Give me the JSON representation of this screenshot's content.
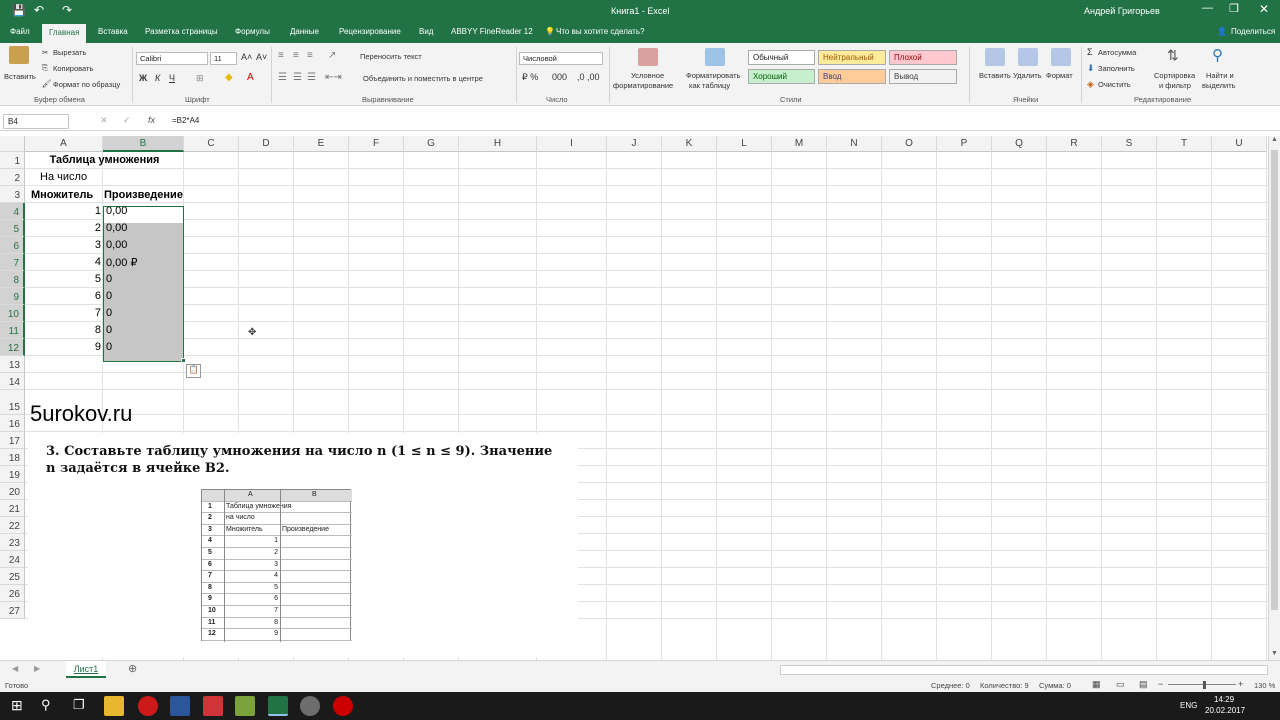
{
  "titlebar": {
    "title": "Книга1 - Excel",
    "user": "Андрей Григорьев"
  },
  "tabs": {
    "file": "Файл",
    "home": "Главная",
    "insert": "Вставка",
    "layout": "Разметка страницы",
    "formulas": "Формулы",
    "data": "Данные",
    "review": "Рецензирование",
    "view": "Вид",
    "abbyy": "ABBYY FineReader 12",
    "tellme": "Что вы хотите сделать?",
    "share": "Поделиться"
  },
  "ribbon": {
    "paste": "Вставить",
    "cut": "Вырезать",
    "copy": "Копировать",
    "format_painter": "Формат по образцу",
    "clipboard": "Буфер обмена",
    "font_name": "Calibri",
    "font_size": "11",
    "font_group": "Шрифт",
    "wrap": "Переносить текст",
    "merge": "Объединить и поместить в центре",
    "alignment": "Выравнивание",
    "number_format": "Числовой",
    "number_group": "Число",
    "cond_format_1": "Условное",
    "cond_format_2": "форматирование",
    "format_table_1": "Форматировать",
    "format_table_2": "как таблицу",
    "styles": [
      "Обычный",
      "Нейтральный",
      "Плохой",
      "Хороший",
      "Ввод",
      "Вывод"
    ],
    "styles_group": "Стили",
    "insert": "Вставить",
    "delete": "Удалить",
    "format": "Формат",
    "cells_group": "Ячейки",
    "autosum": "Автосумма",
    "fill": "Заполнить",
    "clear": "Очистить",
    "sort_1": "Сортировка",
    "sort_2": "и фильтр",
    "find_1": "Найти и",
    "find_2": "выделить",
    "editing_group": "Редактирование"
  },
  "formula_bar": {
    "name_box": "B4",
    "fx": "fx",
    "formula": "=B2*A4"
  },
  "columns": [
    "A",
    "B",
    "C",
    "D",
    "E",
    "F",
    "G",
    "H",
    "I",
    "J",
    "K",
    "L",
    "M",
    "N",
    "O",
    "P",
    "Q",
    "R",
    "S",
    "T",
    "U"
  ],
  "rows": [
    "1",
    "2",
    "3",
    "4",
    "5",
    "6",
    "7",
    "8",
    "9",
    "10",
    "11",
    "12",
    "13",
    "14",
    "15",
    "16",
    "17",
    "18",
    "19",
    "20",
    "21",
    "22",
    "23",
    "24",
    "25",
    "26",
    "27"
  ],
  "cells": {
    "a1": "Таблица умножения",
    "a2": "На число",
    "a3": "Множитель",
    "b3": "Произведение",
    "a_values": [
      "1",
      "2",
      "3",
      "4",
      "5",
      "6",
      "7",
      "8",
      "9"
    ],
    "b_values": [
      "0,00",
      "0,00",
      "0,00",
      "0,00 ₽",
      "0",
      "0",
      "0",
      "0",
      "0"
    ],
    "watermark": "5urokov.ru"
  },
  "book": {
    "num": "3.",
    "line1": "Составьте таблицу умножения на число n (1 ≤ n ≤ 9). Значение",
    "line2": "n задаётся в ячейке B2.",
    "mini_cols": [
      "A",
      "B"
    ],
    "mini_rows": [
      "1",
      "2",
      "3",
      "4",
      "5",
      "6",
      "7",
      "8",
      "9",
      "10",
      "11",
      "12"
    ],
    "mini_a": [
      "Таблица умножения",
      "на число",
      "Множитель",
      "1",
      "2",
      "3",
      "4",
      "5",
      "6",
      "7",
      "8",
      "9"
    ],
    "mini_b3": "Произведение"
  },
  "sheet": {
    "tab": "Лист1",
    "add": "⊕"
  },
  "status": {
    "ready": "Готово",
    "avg": "Среднее: 0",
    "count": "Количество: 9",
    "sum": "Сумма: 0",
    "zoom": "130 %"
  },
  "taskbar": {
    "lang": "ENG",
    "time": "14:29",
    "date": "20.02.2017"
  }
}
